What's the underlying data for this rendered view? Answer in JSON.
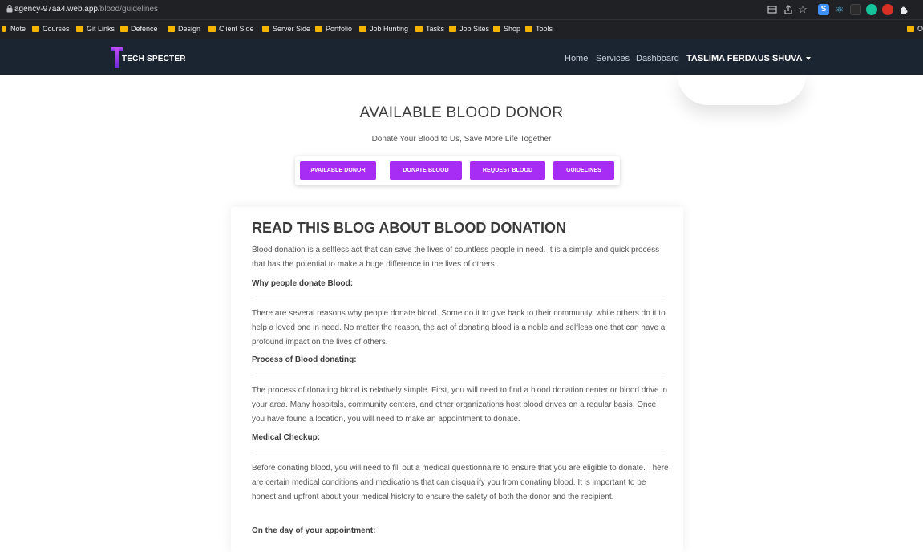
{
  "browser": {
    "url_host": "agency-97aa4.web.app",
    "url_path": "/blood/guidelines",
    "bookmarks": [
      "Note",
      "Courses",
      "Git Links",
      "Defence",
      "Design",
      "Client Side",
      "Server Side",
      "Portfolio",
      "Job Hunting",
      "Tasks",
      "Job Sites",
      "Shop",
      "Tools"
    ],
    "bookmark_right": "O"
  },
  "nav": {
    "brand": "TECH SPECTER",
    "links": [
      "Home",
      "Services",
      "Dashboard"
    ],
    "user": "TASLIMA FERDAUS SHUVA"
  },
  "hero": {
    "title": "AVAILABLE BLOOD DONOR",
    "subtitle": "Donate Your Blood to Us, Save More Life Together",
    "buttons": [
      "AVAILABLE DONOR",
      "DONATE BLOOD",
      "REQUEST BLOOD",
      "GUIDELINES"
    ]
  },
  "blog": {
    "title": "READ THIS BLOG ABOUT BLOOD DONATION",
    "intro": "Blood donation is a selfless act that can save the lives of countless people in need. It is a simple and quick process that has the potential to make a huge difference in the lives of others.",
    "sections": [
      {
        "heading": "Why people donate Blood:",
        "body": "There are several reasons why people donate blood. Some do it to give back to their community, while others do it to help a loved one in need. No matter the reason, the act of donating blood is a noble and selfless one that can have a profound impact on the lives of others."
      },
      {
        "heading": "Process of Blood donating:",
        "body": "The process of donating blood is relatively simple. First, you will need to find a blood donation center or blood drive in your area. Many hospitals, community centers, and other organizations host blood drives on a regular basis. Once you have found a location, you will need to make an appointment to donate."
      },
      {
        "heading": "Medical Checkup:",
        "body": "Before donating blood, you will need to fill out a medical questionnaire to ensure that you are eligible to donate. There are certain medical conditions and medications that can disqualify you from donating blood. It is important to be honest and upfront about your medical history to ensure the safety of both the donor and the recipient."
      },
      {
        "heading": "On the day of your appointment:",
        "body": ""
      }
    ]
  },
  "colors": {
    "nav_bg": "#1b2431",
    "accent": "#a72cf4",
    "browser_bg": "#202124"
  }
}
